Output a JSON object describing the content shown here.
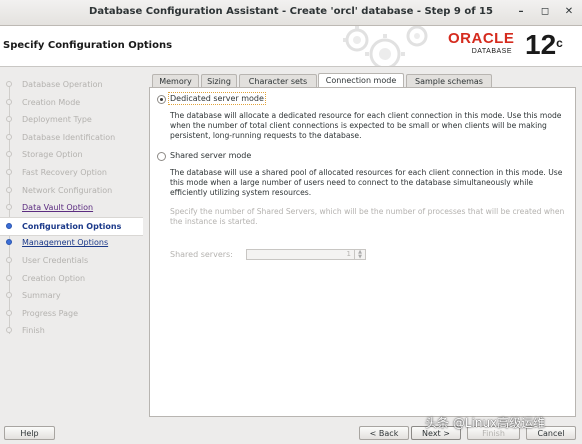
{
  "window": {
    "title": "Database Configuration Assistant - Create 'orcl' database - Step 9 of 15",
    "min_icon": "minimize-icon",
    "max_icon": "maximize-icon",
    "close_icon": "close-icon"
  },
  "header": {
    "page_title": "Specify Configuration Options",
    "brand": "ORACLE",
    "brand_sub": "DATABASE",
    "version": "12",
    "version_sup": "c",
    "brand_color": "#d52b1e"
  },
  "steps": [
    {
      "label": "Database Operation",
      "state": "disabled"
    },
    {
      "label": "Creation Mode",
      "state": "disabled"
    },
    {
      "label": "Deployment Type",
      "state": "disabled"
    },
    {
      "label": "Database Identification",
      "state": "disabled"
    },
    {
      "label": "Storage Option",
      "state": "disabled"
    },
    {
      "label": "Fast Recovery Option",
      "state": "disabled"
    },
    {
      "label": "Network Configuration",
      "state": "disabled"
    },
    {
      "label": "Data Vault Option",
      "state": "link"
    },
    {
      "label": "Configuration Options",
      "state": "current"
    },
    {
      "label": "Management Options",
      "state": "done"
    },
    {
      "label": "User Credentials",
      "state": "disabled"
    },
    {
      "label": "Creation Option",
      "state": "disabled"
    },
    {
      "label": "Summary",
      "state": "disabled"
    },
    {
      "label": "Progress Page",
      "state": "disabled"
    },
    {
      "label": "Finish",
      "state": "disabled"
    }
  ],
  "tabs": [
    {
      "label": "Memory"
    },
    {
      "label": "Sizing"
    },
    {
      "label": "Character sets"
    },
    {
      "label": "Connection mode",
      "active": true
    },
    {
      "label": "Sample schemas"
    }
  ],
  "connection": {
    "dedicated_label": "Dedicated server mode",
    "dedicated_desc": "The database will allocate a dedicated resource for each client connection in this mode. Use this mode when the number of total client connections is expected to be small or when clients will be making persistent, long-running requests to the database.",
    "shared_label": "Shared server mode",
    "shared_desc": "The database will use a shared pool of allocated resources for each client connection in this mode.  Use this mode when a large number of users need to connect to the database simultaneously while efficiently utilizing system resources.",
    "shared_servers_hint": "Specify the number of Shared Servers, which will be the number of processes that will be created when the instance is started.",
    "shared_servers_label": "Shared servers:",
    "shared_servers_value": "1",
    "selected": "dedicated"
  },
  "buttons": {
    "help": "Help",
    "back": "< Back",
    "next": "Next >",
    "finish": "Finish",
    "cancel": "Cancel"
  },
  "watermark": "头条 @Linux高级运维"
}
